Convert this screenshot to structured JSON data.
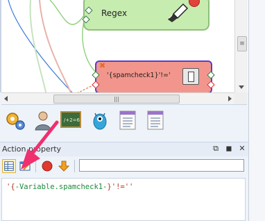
{
  "canvas": {
    "regex_node_label": "Regex",
    "spamcheck_node_label": "'{spamcheck1}'!='"
  },
  "toolbox": {
    "tools": [
      {
        "icon": "gears-icon"
      },
      {
        "icon": "user-icon"
      },
      {
        "icon": "calculator-board-icon"
      },
      {
        "icon": "monster-icon"
      },
      {
        "icon": "document-list-icon"
      },
      {
        "icon": "document-list-icon"
      }
    ]
  },
  "action_panel": {
    "title": "Action property",
    "controls": [
      "⧉",
      "◼",
      "✕"
    ],
    "filter_value": "",
    "code_prefix": "'{",
    "code_variable": "-Variable.spamcheck1-",
    "code_suffix": "}'!=''"
  },
  "colors": {
    "regex_node": "#c7ecb0",
    "spamcheck_node": "#f2968d",
    "selection_border": "#5a3fc6",
    "pointer_arrow": "#f0306e"
  }
}
